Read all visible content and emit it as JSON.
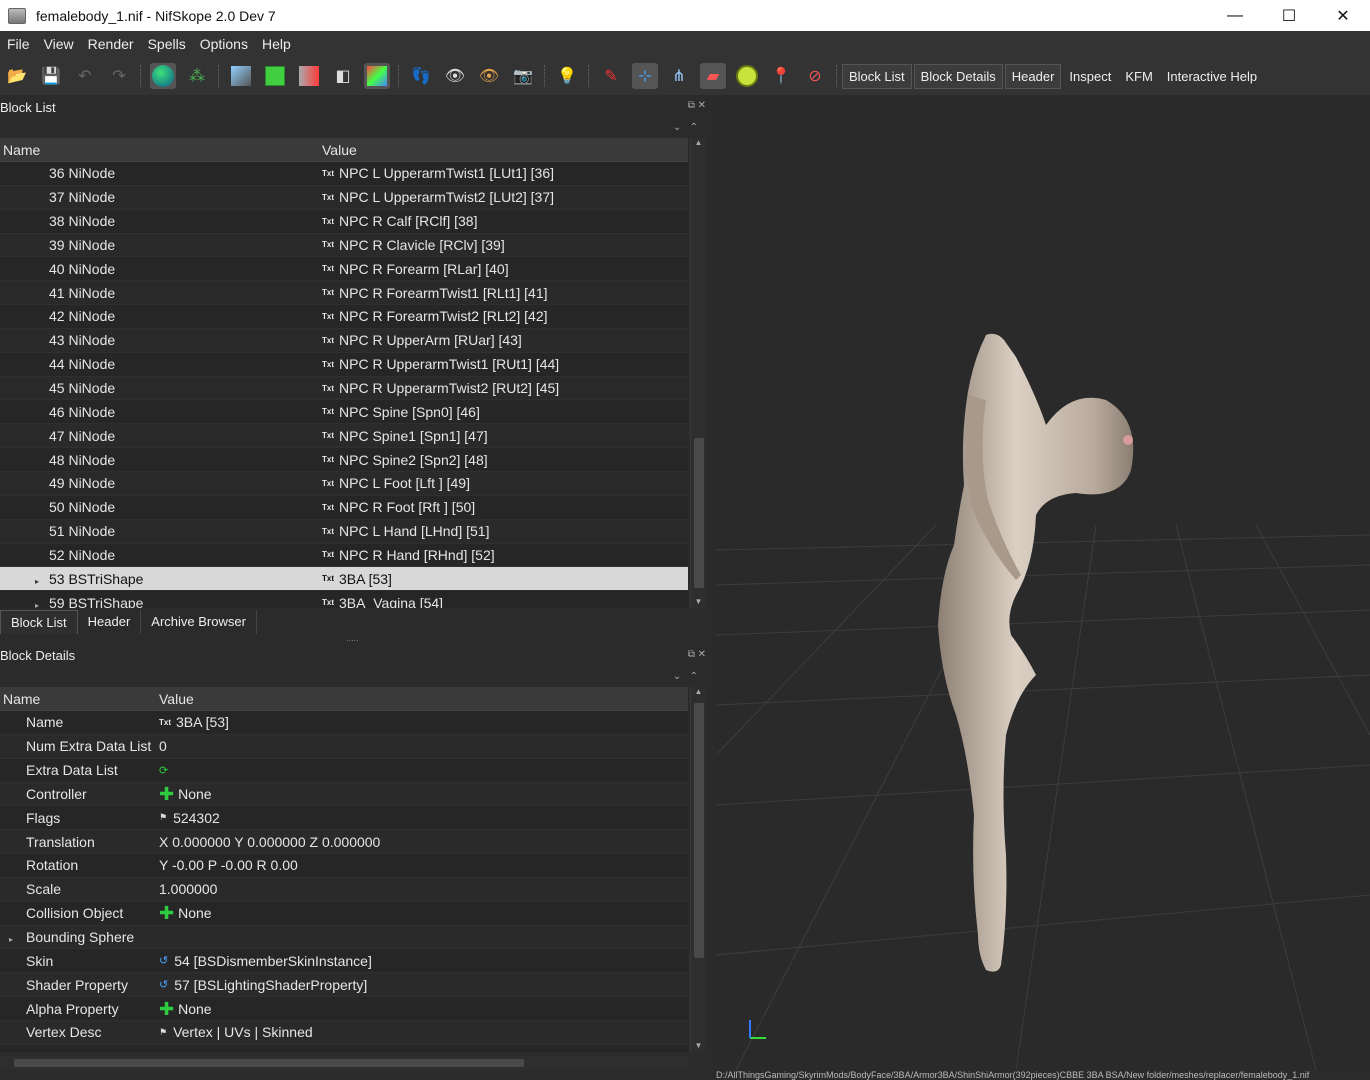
{
  "window": {
    "title": "femalebody_1.nif - NifSkope 2.0 Dev 7"
  },
  "menu": [
    "File",
    "View",
    "Render",
    "Spells",
    "Options",
    "Help"
  ],
  "toolbar": {
    "buttons": [
      "Block List",
      "Block Details",
      "Header",
      "Inspect",
      "KFM",
      "Interactive Help"
    ]
  },
  "block_list": {
    "title": "Block List",
    "col_name": "Name",
    "col_value": "Value",
    "rows": [
      {
        "name": "36 NiNode",
        "value": "NPC L UpperarmTwist1 [LUt1] [36]"
      },
      {
        "name": "37 NiNode",
        "value": "NPC L UpperarmTwist2 [LUt2] [37]"
      },
      {
        "name": "38 NiNode",
        "value": "NPC R Calf [RClf] [38]"
      },
      {
        "name": "39 NiNode",
        "value": "NPC R Clavicle [RClv] [39]"
      },
      {
        "name": "40 NiNode",
        "value": "NPC R Forearm [RLar] [40]"
      },
      {
        "name": "41 NiNode",
        "value": "NPC R ForearmTwist1 [RLt1] [41]"
      },
      {
        "name": "42 NiNode",
        "value": "NPC R ForearmTwist2 [RLt2] [42]"
      },
      {
        "name": "43 NiNode",
        "value": "NPC R UpperArm [RUar] [43]"
      },
      {
        "name": "44 NiNode",
        "value": "NPC R UpperarmTwist1 [RUt1] [44]"
      },
      {
        "name": "45 NiNode",
        "value": "NPC R UpperarmTwist2 [RUt2] [45]"
      },
      {
        "name": "46 NiNode",
        "value": "NPC Spine [Spn0] [46]"
      },
      {
        "name": "47 NiNode",
        "value": "NPC Spine1 [Spn1] [47]"
      },
      {
        "name": "48 NiNode",
        "value": "NPC Spine2 [Spn2] [48]"
      },
      {
        "name": "49 NiNode",
        "value": "NPC L Foot [Lft ] [49]"
      },
      {
        "name": "50 NiNode",
        "value": "NPC R Foot [Rft ] [50]"
      },
      {
        "name": "51 NiNode",
        "value": "NPC L Hand [LHnd] [51]"
      },
      {
        "name": "52 NiNode",
        "value": "NPC R Hand [RHnd] [52]"
      },
      {
        "name": "53 BSTriShape",
        "value": "3BA [53]",
        "selected": true,
        "expandable": true
      },
      {
        "name": "59 BSTriShape",
        "value": "3BA_Vagina [54]",
        "expandable": true
      }
    ],
    "value_icon": "Txt"
  },
  "tabs": [
    "Block List",
    "Header",
    "Archive Browser"
  ],
  "block_details": {
    "title": "Block Details",
    "col_name": "Name",
    "col_value": "Value",
    "rows": [
      {
        "name": "Name",
        "value": "3BA [53]",
        "icon": "txt-icon"
      },
      {
        "name": "Num Extra Data List",
        "value": "0",
        "icon": ""
      },
      {
        "name": "Extra Data List",
        "value": "",
        "icon": "cycle-icon"
      },
      {
        "name": "Controller",
        "value": "None",
        "icon": "plus-icon"
      },
      {
        "name": "Flags",
        "value": "524302",
        "icon": "flag-icon"
      },
      {
        "name": "Translation",
        "value": "X 0.000000 Y 0.000000 Z 0.000000",
        "icon": ""
      },
      {
        "name": "Rotation",
        "value": "Y -0.00 P -0.00 R 0.00",
        "icon": ""
      },
      {
        "name": "Scale",
        "value": "1.000000",
        "icon": ""
      },
      {
        "name": "Collision Object",
        "value": "None",
        "icon": "plus-icon"
      },
      {
        "name": "Bounding Sphere",
        "value": "",
        "icon": "",
        "expandable": true
      },
      {
        "name": "Skin",
        "value": "54 [BSDismemberSkinInstance]",
        "icon": "link-icon"
      },
      {
        "name": "Shader Property",
        "value": "57 [BSLightingShaderProperty]",
        "icon": "link-icon"
      },
      {
        "name": "Alpha Property",
        "value": "None",
        "icon": "plus-icon"
      },
      {
        "name": "Vertex Desc",
        "value": "Vertex | UVs | Skinned",
        "icon": "flag-icon"
      }
    ]
  },
  "status": {
    "path": "D:/AllThingsGaming/SkyrimMods/BodyFace/3BA/Armor3BA/ShinShiArmor(392pieces)CBBE 3BA BSA/New folder/meshes/replacer/femalebody_1.nif"
  }
}
